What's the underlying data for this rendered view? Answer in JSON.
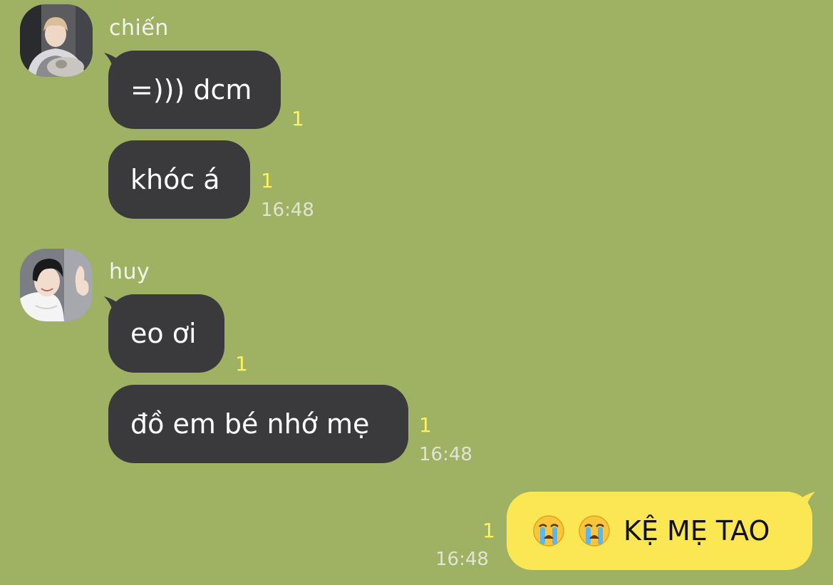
{
  "conversation": {
    "groups": [
      {
        "sender": "chiến",
        "avatar": "profile-photo",
        "messages": [
          {
            "text": "=))) dcm",
            "unread": "1"
          },
          {
            "text": "khóc á",
            "unread": "1",
            "time": "16:48"
          }
        ]
      },
      {
        "sender": "huy",
        "avatar": "profile-photo",
        "messages": [
          {
            "text": "eo ơi",
            "unread": "1"
          },
          {
            "text": "đồ em bé nhớ mẹ",
            "unread": "1",
            "time": "16:48"
          }
        ]
      }
    ],
    "outgoing": {
      "emoji": [
        "loudly-crying-face-icon",
        "loudly-crying-face-icon"
      ],
      "text": "KỆ MẸ TAO",
      "unread": "1",
      "time": "16:48"
    }
  },
  "colors": {
    "background": "#9fb263",
    "incoming_bubble": "#3a3a3c",
    "outgoing_bubble": "#fbe653",
    "unread_count": "#fff25a"
  }
}
